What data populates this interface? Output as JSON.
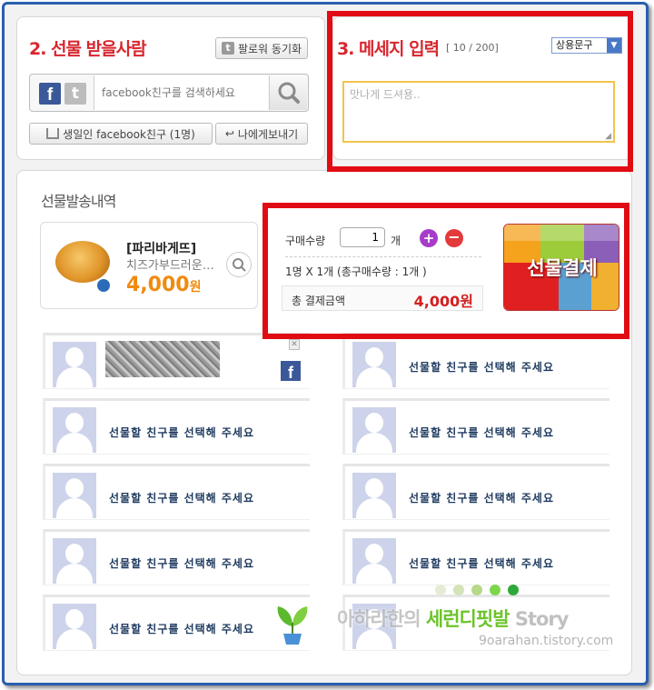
{
  "receiver": {
    "title": "2. 선물 받을사람",
    "sync_button": "팔로워 동기화",
    "search_placeholder": "facebook친구를 검색하세요",
    "birthday_button": "생일인 facebook친구 (1명)",
    "send_to_me_button": "나에게보내기"
  },
  "message": {
    "title": "3. 메세지 입력",
    "counter": "[ 10 / 200]",
    "select_value": "상용문구",
    "textarea_value": "맛나게 드셔용.."
  },
  "history": {
    "title": "선물발송내역",
    "product": {
      "brand": "[파리바게뜨]",
      "name": "치즈가부드러운…",
      "price": "4,000",
      "unit": "원"
    }
  },
  "order": {
    "qty_label": "구매수량",
    "qty_value": "1",
    "qty_unit": "개",
    "summary": "1명 X 1개 (총구매수량 : 1개 )",
    "total_label": "총 결제금액",
    "total_value": "4,000원",
    "pay_button": "선물결제",
    "tile_colors": [
      "#f5a21c",
      "#9ccc3a",
      "#8b5fb8",
      "#e02020",
      "#5aa0d0",
      "#f0b030",
      "#d42525"
    ]
  },
  "friend_slots": {
    "empty_label": "선물할 친구를 선택해 주세요",
    "first_slot_network": "f"
  },
  "watermark": {
    "line1_a": "아하라한의",
    "line1_b": "세런디핏발",
    "line1_c": "Story",
    "line2": "9oarahan.tistory.com"
  }
}
